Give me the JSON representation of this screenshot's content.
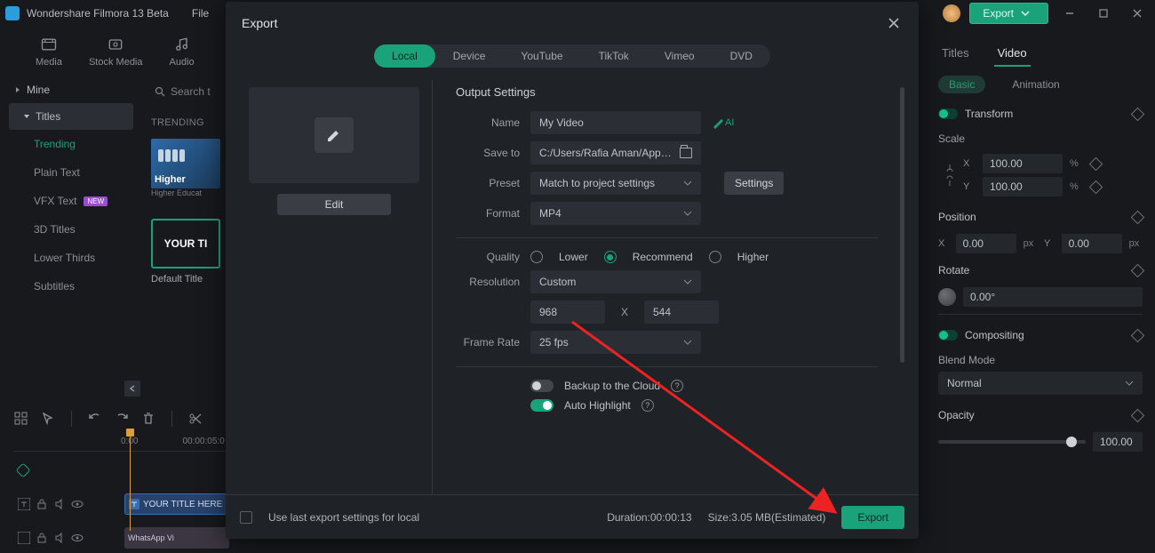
{
  "titlebar": {
    "app": "Wondershare Filmora 13 Beta",
    "file": "File",
    "export": "Export"
  },
  "modes": {
    "media": "Media",
    "stock": "Stock Media",
    "audio": "Audio"
  },
  "sidebar": {
    "mine": "Mine",
    "titles": "Titles",
    "items": [
      "Trending",
      "Plain Text",
      "VFX Text",
      "3D Titles",
      "Lower Thirds",
      "Subtitles"
    ],
    "new": "NEW"
  },
  "mid": {
    "search": "Search t",
    "trending": "TRENDING",
    "thumb_title": "Higher",
    "thumb_sub": "Higher Educat",
    "default_tile": "YOUR TI",
    "default_lab": "Default Title"
  },
  "timeline": {
    "t0": "0:00",
    "t1": "00:00:05:0",
    "clip_title": "YOUR TITLE HERE",
    "clip_vid": "WhatsApp Vi"
  },
  "inspector": {
    "tabs": {
      "titles": "Titles",
      "video": "Video"
    },
    "basic": "Basic",
    "animation": "Animation",
    "transform": "Transform",
    "scale": "Scale",
    "x": "X",
    "y": "Y",
    "sx": "100.00",
    "sy": "100.00",
    "pct": "%",
    "position": "Position",
    "px": "0.00",
    "py": "0.00",
    "pxu": "px",
    "rotate": "Rotate",
    "rv": "0.00°",
    "compositing": "Compositing",
    "blend": "Blend Mode",
    "blendv": "Normal",
    "opacity": "Opacity",
    "ov": "100.00"
  },
  "modal": {
    "title": "Export",
    "tabs": {
      "local": "Local",
      "device": "Device",
      "youtube": "YouTube",
      "tiktok": "TikTok",
      "vimeo": "Vimeo",
      "dvd": "DVD"
    },
    "edit": "Edit",
    "os": "Output Settings",
    "name": "Name",
    "name_v": "My Video",
    "save": "Save to",
    "save_v": "C:/Users/Rafia Aman/AppData",
    "preset": "Preset",
    "preset_v": "Match to project settings",
    "settings": "Settings",
    "format": "Format",
    "format_v": "MP4",
    "quality": "Quality",
    "q_lower": "Lower",
    "q_rec": "Recommend",
    "q_higher": "Higher",
    "res": "Resolution",
    "res_v": "Custom",
    "w": "968",
    "h": "544",
    "cross": "X",
    "fr": "Frame Rate",
    "fr_v": "25 fps",
    "cloud": "Backup to the Cloud",
    "autohl": "Auto Highlight",
    "uselast": "Use last export settings for local",
    "duration": "Duration:00:00:13",
    "size": "Size:3.05 MB(Estimated)",
    "export": "Export"
  }
}
